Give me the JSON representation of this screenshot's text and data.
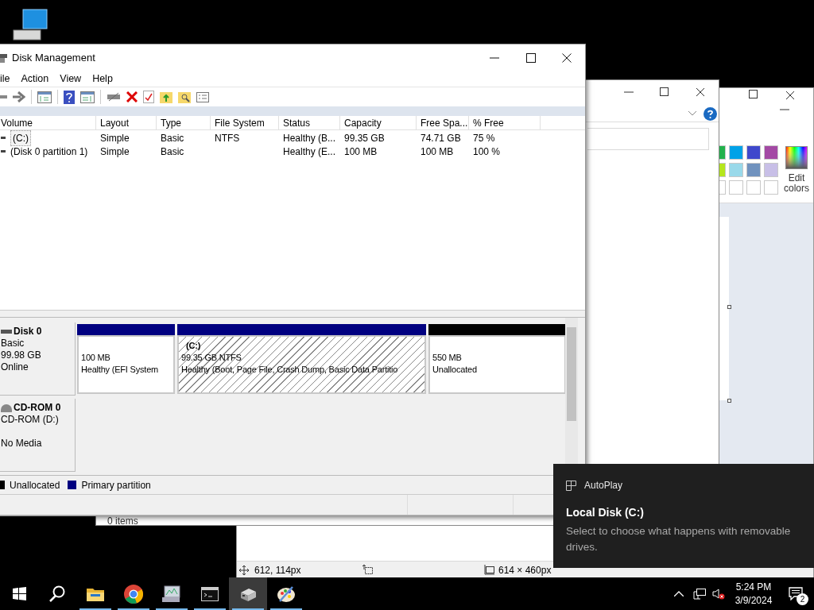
{
  "paint_window": {
    "palette": [
      {
        "color": "#22b14c"
      },
      {
        "color": "#00a2e8"
      },
      {
        "color": "#3f48cc"
      },
      {
        "color": "#a349a4"
      },
      {
        "color": "#b5e61d"
      },
      {
        "color": "#99d9ea"
      },
      {
        "color": "#7092be"
      },
      {
        "color": "#c8bfe7"
      },
      {
        "color": "#ffffff"
      },
      {
        "color": "#ffffff"
      },
      {
        "color": "#ffffff"
      },
      {
        "color": "#ffffff"
      }
    ],
    "edit_colors": "Edit colors",
    "status_bar": {
      "cursor_position": "612, 114px",
      "canvas_size": "614 × 460px"
    }
  },
  "explorer_window": {
    "status": "0 items"
  },
  "disk_management": {
    "title": "Disk Management",
    "menu": [
      "ile",
      "Action",
      "View",
      "Help"
    ],
    "columns": [
      "Volume",
      "Layout",
      "Type",
      "File System",
      "Status",
      "Capacity",
      "Free Spa...",
      "% Free"
    ],
    "rows": [
      {
        "cells": [
          "(C:)",
          "Simple",
          "Basic",
          "NTFS",
          "Healthy (B...",
          "99.35 GB",
          "74.71 GB",
          "75 %"
        ],
        "focused": true
      },
      {
        "cells": [
          "(Disk 0 partition 1)",
          "Simple",
          "Basic",
          "",
          "Healthy (E...",
          "100 MB",
          "100 MB",
          "100 %"
        ],
        "focused": false
      }
    ],
    "disks": [
      {
        "kind": "disk",
        "name": "Disk 0",
        "type": "Basic",
        "size": "99.98 GB",
        "state": "Online",
        "partitions": [
          {
            "kind": "primary",
            "selected": false,
            "size": "100 MB",
            "status": "Healthy (EFI System"
          },
          {
            "kind": "primary",
            "selected": true,
            "label": "(C:)",
            "size": "99.35 GB NTFS",
            "status": "Healthy (Boot, Page File, Crash Dump, Basic Data Partitio"
          },
          {
            "kind": "unallocated",
            "selected": false,
            "size": "550 MB",
            "status": "Unallocated"
          }
        ]
      },
      {
        "kind": "cdrom",
        "name": "CD-ROM 0",
        "type": "CD-ROM (D:)",
        "state": "No Media"
      }
    ],
    "legend": [
      {
        "label": "Unallocated",
        "color": "#000000"
      },
      {
        "label": "Primary partition",
        "color": "#000080"
      }
    ]
  },
  "toast": {
    "app": "AutoPlay",
    "title": "Local Disk (C:)",
    "message": "Select to choose what happens with removable drives."
  },
  "taskbar": {
    "apps": [
      {
        "kind": "start",
        "running": false,
        "selected": false
      },
      {
        "kind": "search",
        "running": false,
        "selected": false
      },
      {
        "kind": "folder",
        "running": true,
        "selected": false
      },
      {
        "kind": "browser",
        "running": true,
        "selected": false
      },
      {
        "kind": "monitor",
        "running": true,
        "selected": false
      },
      {
        "kind": "terminal",
        "running": true,
        "selected": false
      },
      {
        "kind": "disk",
        "running": true,
        "selected": true
      },
      {
        "kind": "paint",
        "running": true,
        "selected": false
      }
    ],
    "time": "5:24 PM",
    "date": "3/9/2024",
    "notifications": "2"
  }
}
